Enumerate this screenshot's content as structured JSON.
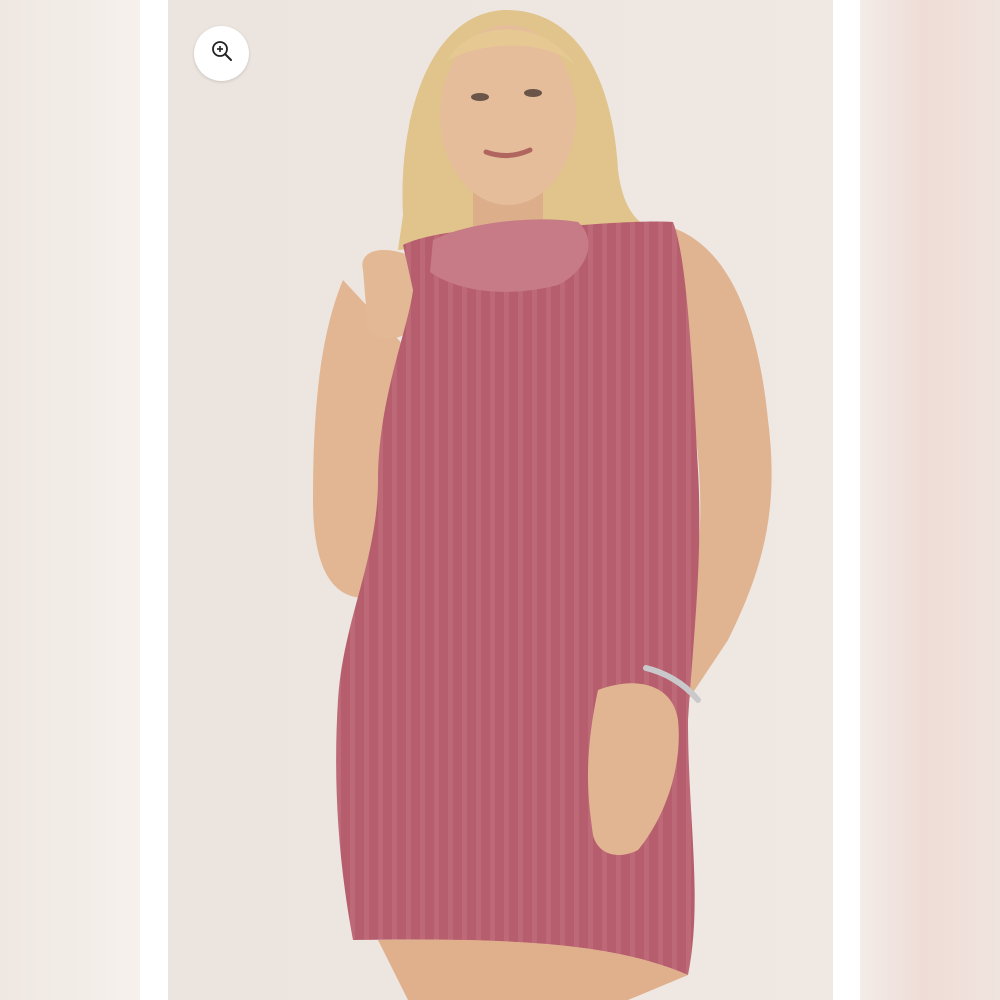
{
  "gallery": {
    "zoom_button": {
      "icon": "zoom-in-icon"
    },
    "main_image": {
      "subject": "product-photo"
    },
    "colors": {
      "backdrop": "#eee7e1",
      "dress": "#b8606f",
      "skin": "#e3b894",
      "hair": "#e2c58c"
    }
  }
}
